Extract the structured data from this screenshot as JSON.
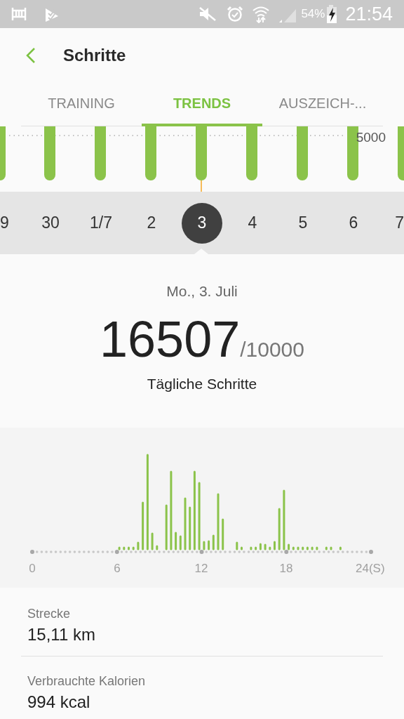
{
  "status_bar": {
    "battery_text": "54%",
    "time": "21:54"
  },
  "header": {
    "title": "Schritte"
  },
  "tabs": [
    {
      "label": "TRAINING",
      "selected": false
    },
    {
      "label": "TRENDS",
      "selected": true
    },
    {
      "label": "AUSZEICH-...",
      "selected": false
    }
  ],
  "week_chart": {
    "reference_label": "5000"
  },
  "date_strip": [
    {
      "label": "9",
      "selected": false
    },
    {
      "label": "30",
      "selected": false
    },
    {
      "label": "1/7",
      "selected": false
    },
    {
      "label": "2",
      "selected": false
    },
    {
      "label": "3",
      "selected": true
    },
    {
      "label": "4",
      "selected": false
    },
    {
      "label": "5",
      "selected": false
    },
    {
      "label": "6",
      "selected": false
    },
    {
      "label": "7",
      "selected": false
    }
  ],
  "summary": {
    "date": "Mo., 3. Juli",
    "steps": "16507",
    "goal": "/10000",
    "label": "Tägliche Schritte"
  },
  "hourly_chart": {
    "axis_labels": [
      "0",
      "6",
      "12",
      "18",
      "24(S)"
    ]
  },
  "stats": [
    {
      "label": "Strecke",
      "value": "15,11 km"
    },
    {
      "label": "Verbrauchte Kalorien",
      "value": "994 kcal"
    }
  ]
}
